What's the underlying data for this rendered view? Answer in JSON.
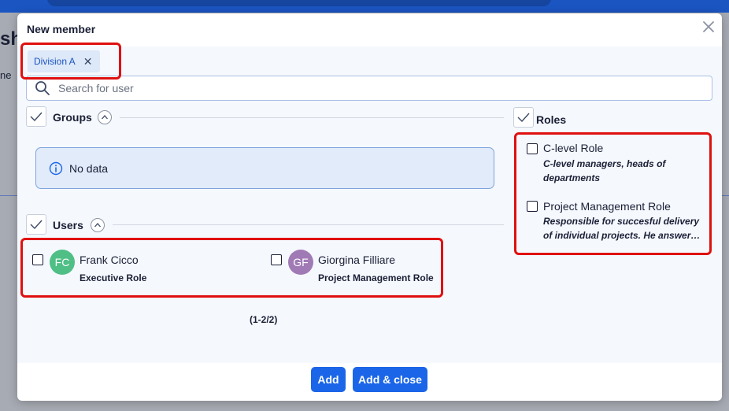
{
  "background": {
    "text_1": "sh",
    "text_2": "ne"
  },
  "modal": {
    "title": "New member",
    "close_icon": "close-icon"
  },
  "chip": {
    "label": "Division A",
    "remove_symbol": "✕"
  },
  "search": {
    "placeholder": "Search for user",
    "value": ""
  },
  "groups": {
    "label": "Groups",
    "empty_text": "No data"
  },
  "users": {
    "label": "Users",
    "items": [
      {
        "initials": "FC",
        "name": "Frank Cicco",
        "role": "Executive Role",
        "avatar_color": "#4fbf86"
      },
      {
        "initials": "GF",
        "name": "Giorgina Filliare",
        "role": "Project Management Role",
        "avatar_color": "#a07ab5"
      }
    ],
    "pagination": "(1-2/2)"
  },
  "roles": {
    "label": "Roles",
    "items": [
      {
        "title": "C-level Role",
        "desc_line1": "C-level managers, heads of",
        "desc_line2": "departments"
      },
      {
        "title": "Project Management Role",
        "desc_line1": "Responsible for succesful delivery",
        "desc_line2": "of individual projects. He answers to the client and to the project sponsor"
      }
    ]
  },
  "footer": {
    "add_label": "Add",
    "add_close_label": "Add & close"
  },
  "colors": {
    "accent": "#1b66e8",
    "highlight": "#e01010",
    "chip_bg": "#dde8f8"
  }
}
